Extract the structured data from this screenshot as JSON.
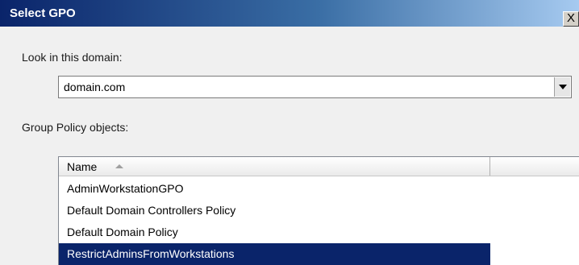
{
  "window": {
    "title": "Select GPO",
    "close_label": "X"
  },
  "domain": {
    "label": "Look in this domain:",
    "value": "domain.com"
  },
  "gpo": {
    "label": "Group Policy objects:",
    "column_name": "Name",
    "column_second": "",
    "sort_direction": "ascending",
    "items": [
      {
        "name": "AdminWorkstationGPO",
        "selected": false
      },
      {
        "name": "Default Domain Controllers Policy",
        "selected": false
      },
      {
        "name": "Default Domain Policy",
        "selected": false
      },
      {
        "name": "RestrictAdminsFromWorkstations",
        "selected": true
      }
    ]
  },
  "colors": {
    "selection": "#0a246a",
    "titlebar_start": "#0a246a",
    "titlebar_end": "#a6caf0"
  }
}
